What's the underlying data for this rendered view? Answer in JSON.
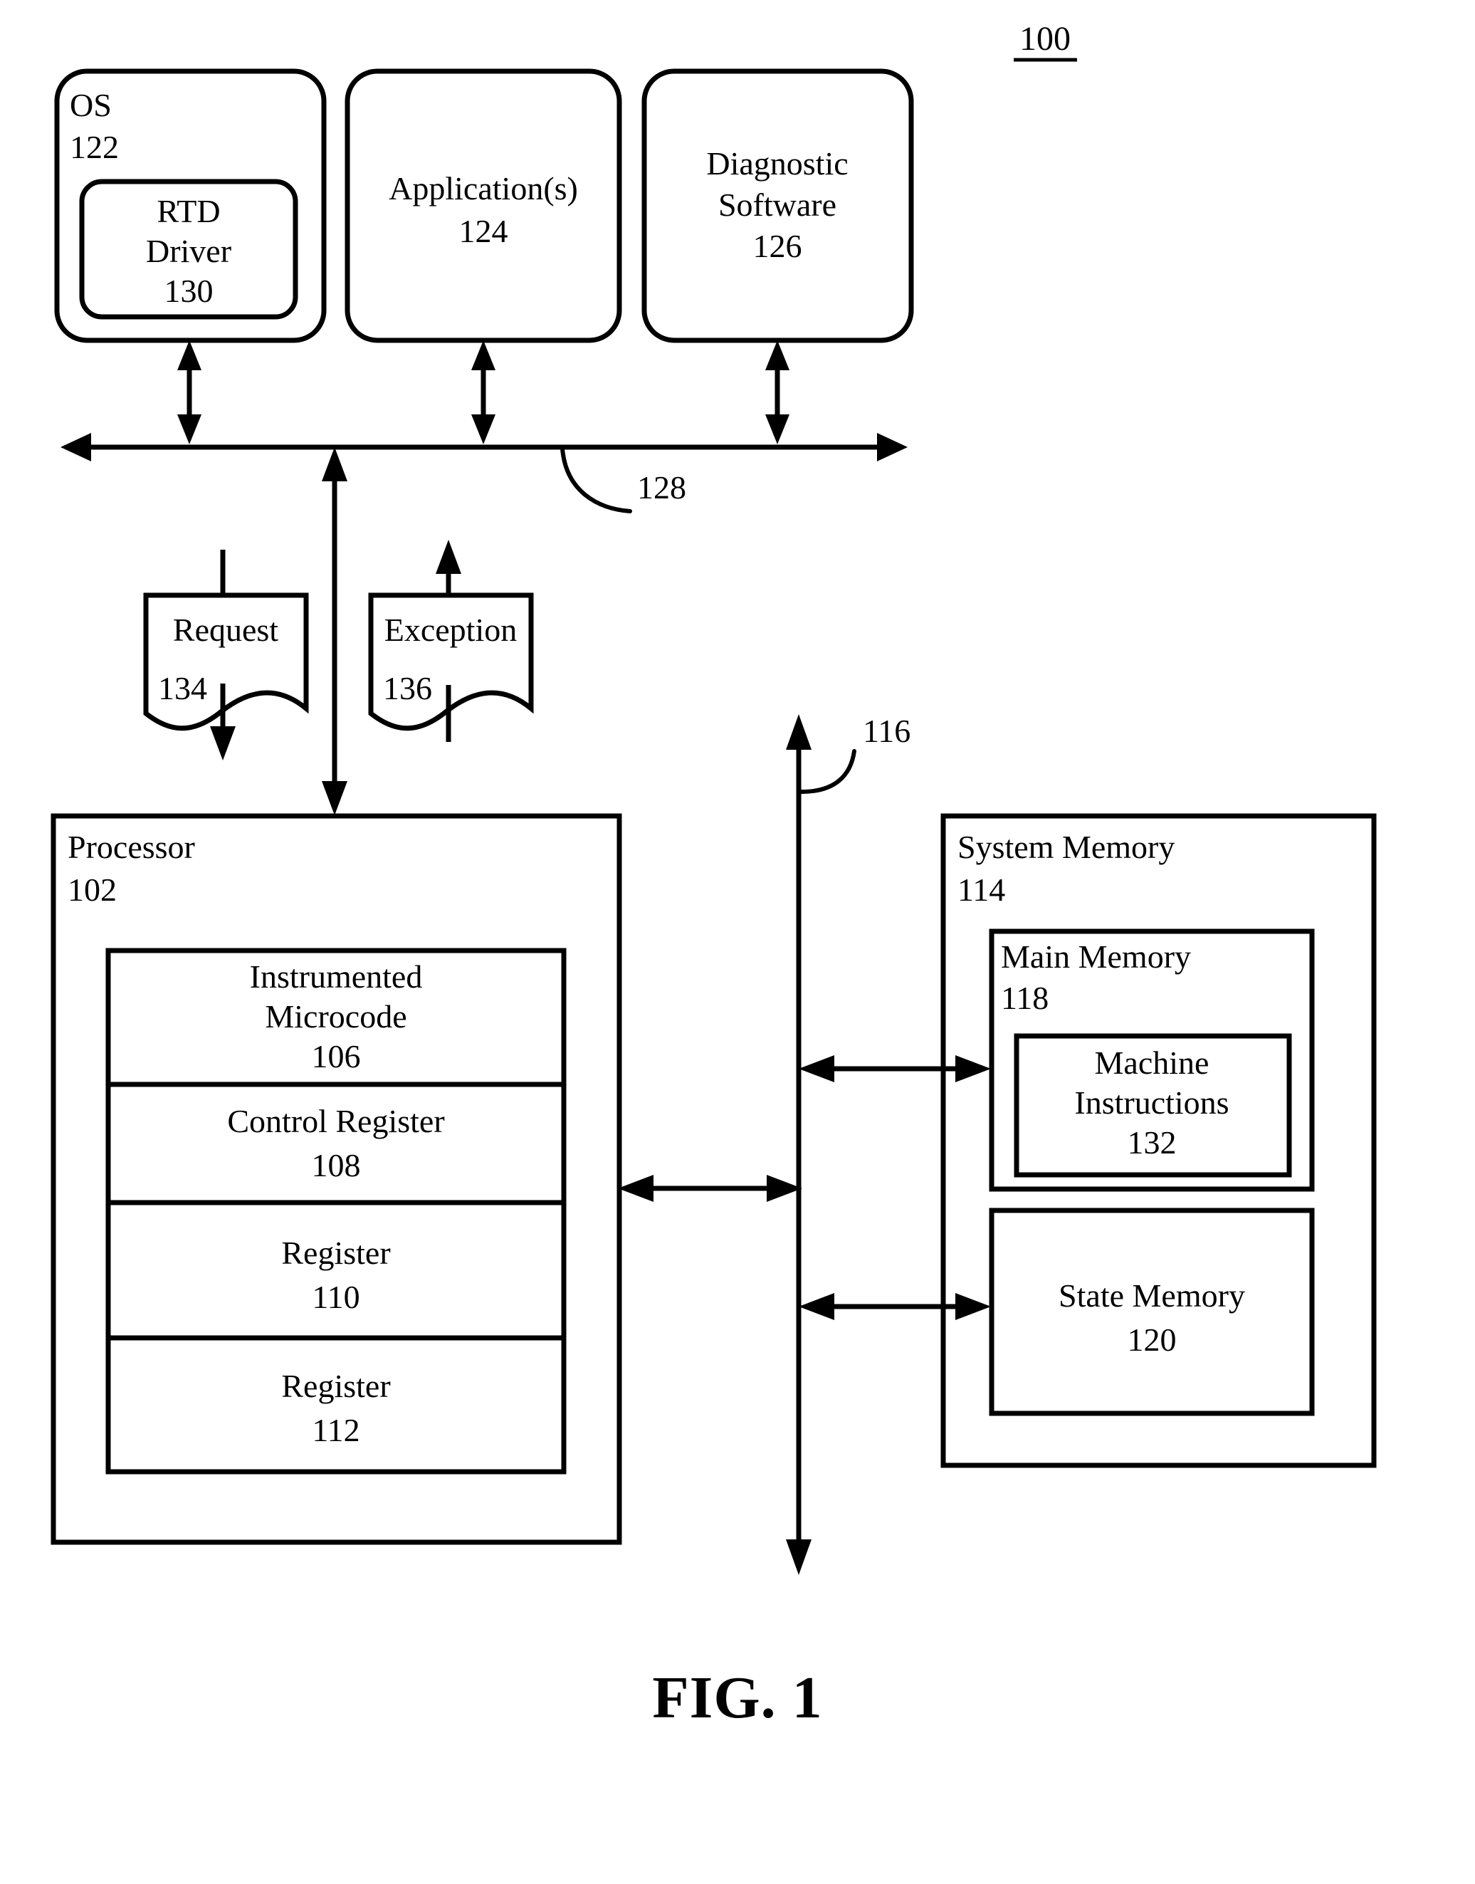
{
  "figure": {
    "caption": "FIG. 1",
    "system_ref": "100"
  },
  "top_modules": [
    {
      "id": "os",
      "title": "OS",
      "ref": "122",
      "title_align": "corner",
      "nested": {
        "id": "rtd-driver",
        "title_line1": "RTD",
        "title_line2": "Driver",
        "ref": "130"
      }
    },
    {
      "id": "applications",
      "title": "Application(s)",
      "ref": "124",
      "title_align": "center"
    },
    {
      "id": "diagnostic-software",
      "title_line1": "Diagnostic",
      "title_line2": "Software",
      "ref": "126",
      "title_align": "center"
    }
  ],
  "bus": {
    "id": "software-bus",
    "ref": "128"
  },
  "messages": [
    {
      "id": "request",
      "label": "Request",
      "ref": "134",
      "direction": "down"
    },
    {
      "id": "exception",
      "label": "Exception",
      "ref": "136",
      "direction": "up"
    }
  ],
  "processor": {
    "title": "Processor",
    "ref": "102",
    "units": [
      {
        "id": "instrumented-microcode",
        "line1": "Instrumented",
        "line2": "Microcode",
        "ref": "106"
      },
      {
        "id": "control-register",
        "line1": "Control Register",
        "line2": "",
        "ref": "108"
      },
      {
        "id": "register-110",
        "line1": "Register",
        "line2": "",
        "ref": "110"
      },
      {
        "id": "register-112",
        "line1": "Register",
        "line2": "",
        "ref": "112"
      }
    ]
  },
  "system_memory": {
    "title": "System Memory",
    "ref": "114",
    "main_memory": {
      "title": "Main Memory",
      "ref": "118",
      "machine_instructions": {
        "line1": "Machine",
        "line2": "Instructions",
        "ref": "132"
      }
    },
    "state_memory": {
      "title": "State Memory",
      "ref": "120"
    }
  },
  "system_bus": {
    "id": "hardware-bus",
    "ref": "116"
  }
}
